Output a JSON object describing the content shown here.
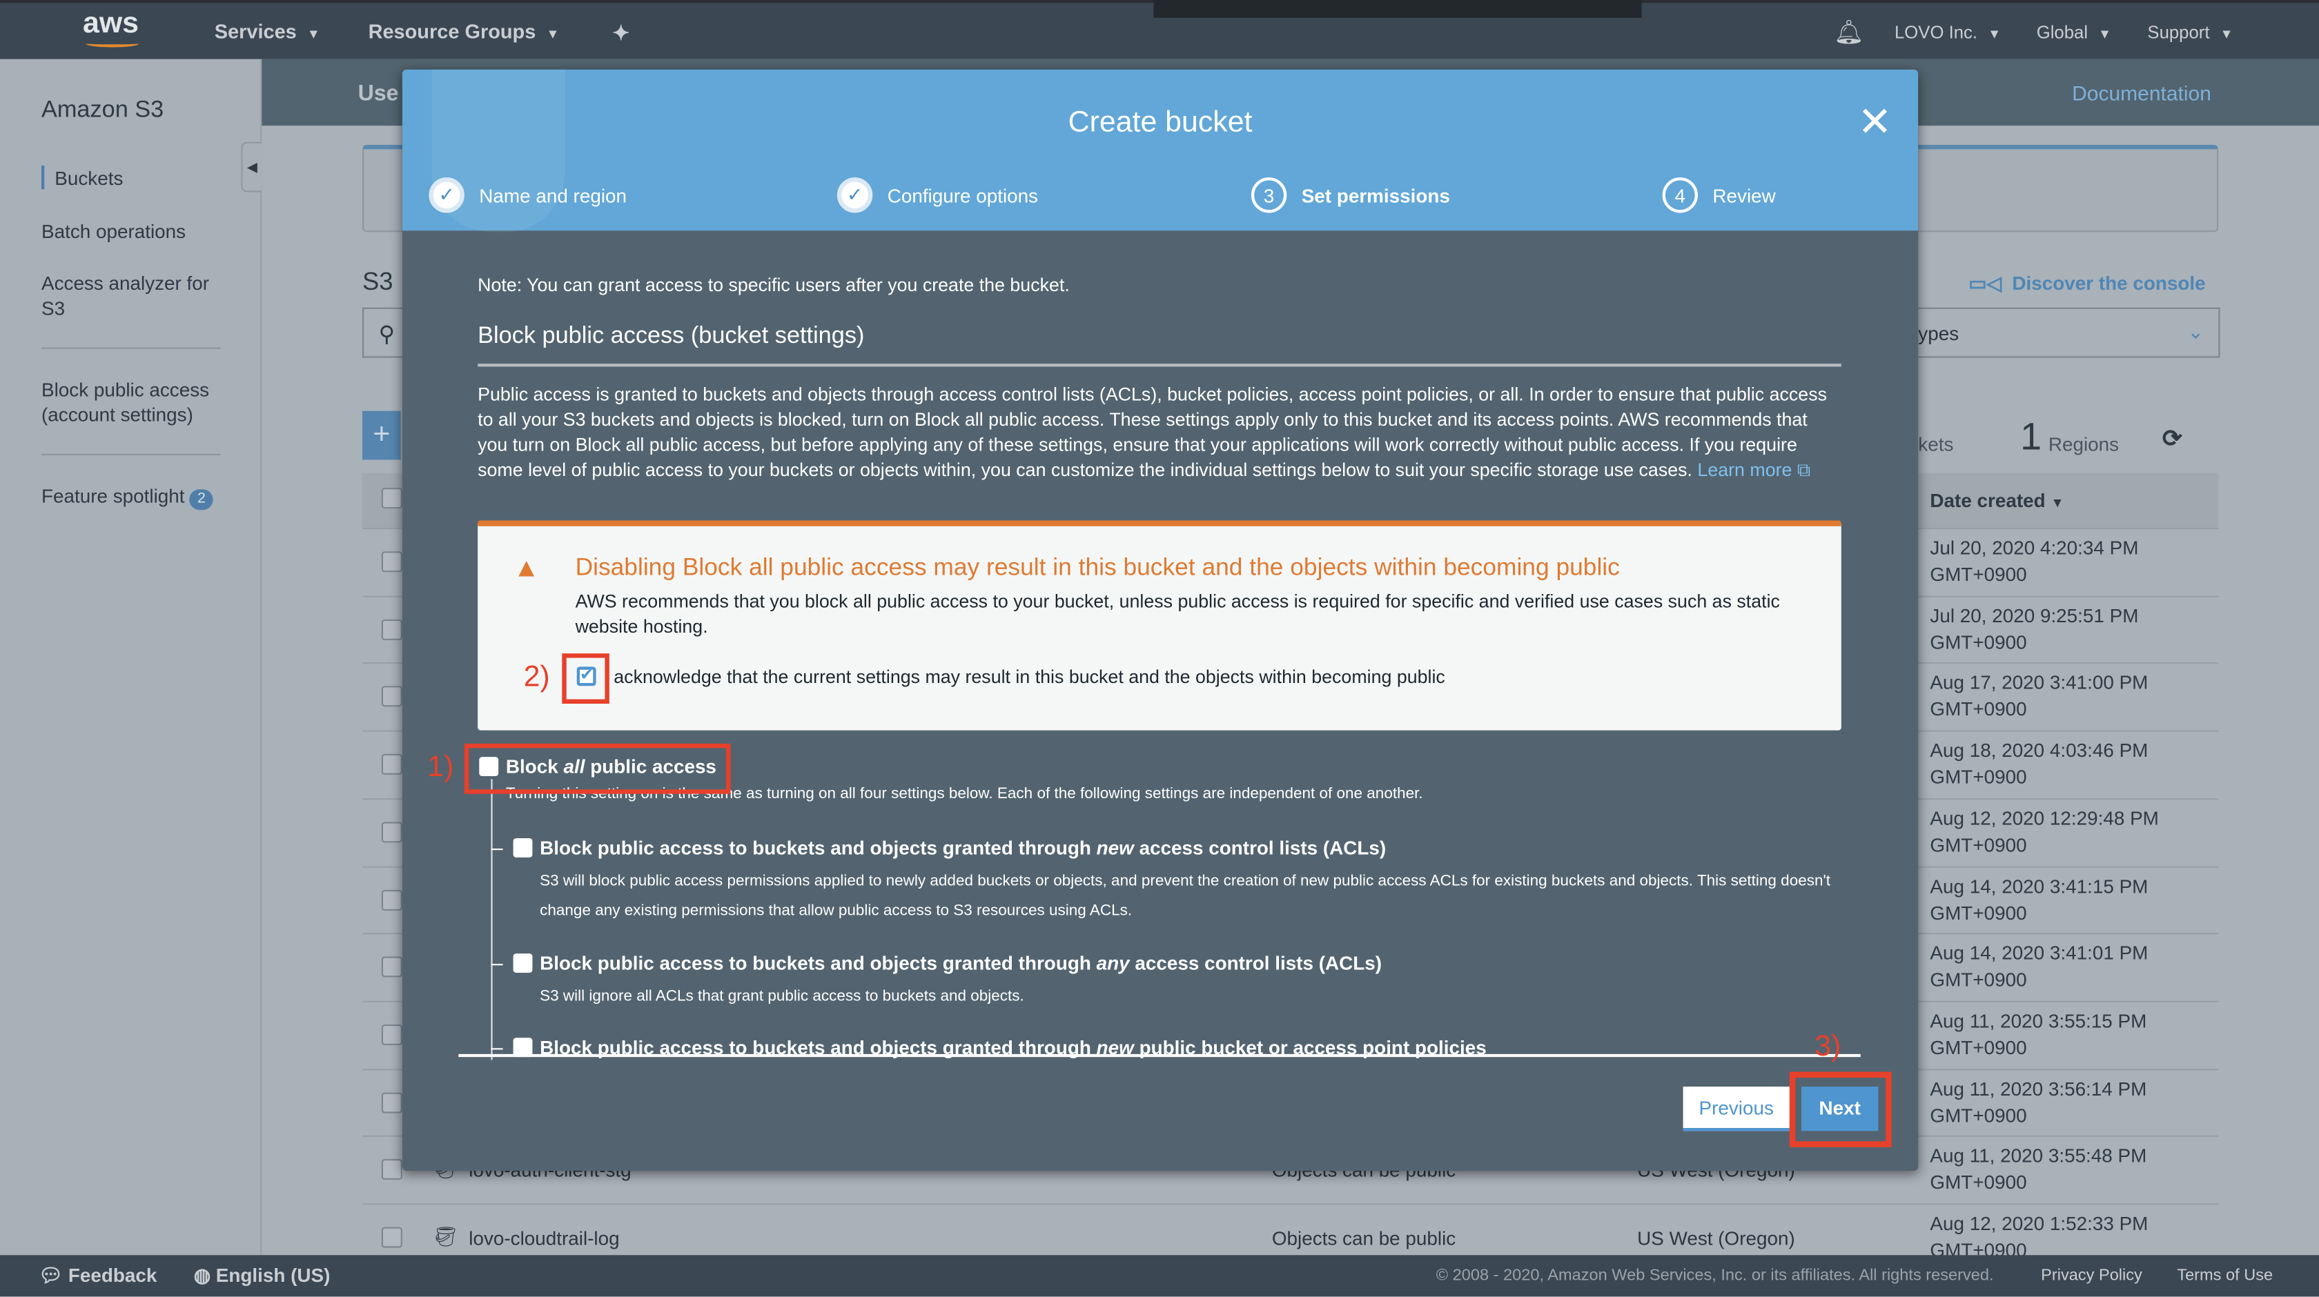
{
  "topnav": {
    "logo": "aws",
    "services": "Services",
    "resource_groups": "Resource Groups",
    "account": "LOVO Inc.",
    "region": "Global",
    "support": "Support"
  },
  "sidebar": {
    "title": "Amazon S3",
    "items": [
      {
        "label": "Buckets"
      },
      {
        "label": "Batch operations"
      },
      {
        "label": "Access analyzer for S3"
      },
      {
        "label": "Block public access (account settings)"
      },
      {
        "label": "Feature spotlight",
        "badge": "2"
      }
    ]
  },
  "main": {
    "header_partial": "Use",
    "documentation": "Documentation",
    "section_partial": "S3",
    "discover": "Discover the console",
    "filter_partial": "ypes",
    "buckets_partial": "kets",
    "regions_count": "1",
    "regions_label": "Regions",
    "date_header": "Date created",
    "rows": [
      {
        "date": "Jul 20, 2020 4:20:34 PM",
        "tz": "GMT+0900"
      },
      {
        "date": "Jul 20, 2020 9:25:51 PM",
        "tz": "GMT+0900"
      },
      {
        "date": "Aug 17, 2020 3:41:00 PM",
        "tz": "GMT+0900"
      },
      {
        "date": "Aug 18, 2020 4:03:46 PM",
        "tz": "GMT+0900"
      },
      {
        "date": "Aug 12, 2020 12:29:48 PM",
        "tz": "GMT+0900"
      },
      {
        "date": "Aug 14, 2020 3:41:15 PM",
        "tz": "GMT+0900"
      },
      {
        "date": "Aug 14, 2020 3:41:01 PM",
        "tz": "GMT+0900"
      },
      {
        "date": "Aug 11, 2020 3:55:15 PM",
        "tz": "GMT+0900"
      },
      {
        "date": "Aug 11, 2020 3:56:14 PM",
        "tz": "GMT+0900"
      },
      {
        "name": "lovo-auth-client-stg",
        "access": "Objects can be public",
        "region": "US West (Oregon)",
        "date": "Aug 11, 2020 3:55:48 PM",
        "tz": "GMT+0900"
      },
      {
        "name": "lovo-cloudtrail-log",
        "access": "Objects can be public",
        "region": "US West (Oregon)",
        "date": "Aug 12, 2020 1:52:33 PM",
        "tz": "GMT+0900"
      }
    ]
  },
  "modal": {
    "title": "Create bucket",
    "steps": [
      {
        "num": "1",
        "label": "Name and region",
        "state": "done"
      },
      {
        "num": "2",
        "label": "Configure options",
        "state": "done"
      },
      {
        "num": "3",
        "label": "Set permissions",
        "state": "current"
      },
      {
        "num": "4",
        "label": "Review",
        "state": "pending"
      }
    ],
    "note": "Note: You can grant access to specific users after you create the bucket.",
    "section_title": "Block public access (bucket settings)",
    "description": "Public access is granted to buckets and objects through access control lists (ACLs), bucket policies, access point policies, or all. In order to ensure that public access to all your S3 buckets and objects is blocked, turn on Block all public access. These settings apply only to this bucket and its access points. AWS recommends that you turn on Block all public access, but before applying any of these settings, ensure that your applications will work correctly without public access. If you require some level of public access to your buckets or objects within, you can customize the individual settings below to suit your specific storage use cases.",
    "learn_more": "Learn more",
    "warning": {
      "title": "Disabling Block all public access may result in this bucket and the objects within becoming public",
      "body": "AWS recommends that you block all public access to your bucket, unless public access is required for specific and verified use cases such as static website hosting.",
      "acknowledge": "acknowledge that the current settings may result in this bucket and the objects within becoming public",
      "acknowledged": true
    },
    "block_all": {
      "label_pre": "Block ",
      "label_em": "all",
      "label_post": " public access",
      "checked": false,
      "desc": "Turning this setting on is the same as turning on all four settings below. Each of the following settings are independent of one another."
    },
    "options": [
      {
        "pre": "Block public access to buckets and objects granted through ",
        "em": "new",
        "post": " access control lists (ACLs)",
        "desc": "S3 will block public access permissions applied to newly added buckets or objects, and prevent the creation of new public access ACLs for existing buckets and objects. This setting doesn't change any existing permissions that allow public access to S3 resources using ACLs.",
        "checked": false
      },
      {
        "pre": "Block public access to buckets and objects granted through ",
        "em": "any",
        "post": " access control lists (ACLs)",
        "desc": "S3 will ignore all ACLs that grant public access to buckets and objects.",
        "checked": false
      },
      {
        "pre": "Block public access to buckets and objects granted through ",
        "em": "new",
        "post": " public bucket or access point policies",
        "checked": false
      }
    ],
    "previous": "Previous",
    "next": "Next"
  },
  "annotations": {
    "a1": "1)",
    "a2": "2)",
    "a3": "3)",
    "color": "#e8402a"
  },
  "footer": {
    "feedback": "Feedback",
    "language": "English (US)",
    "copyright": "© 2008 - 2020, Amazon Web Services, Inc. or its affiliates. All rights reserved.",
    "privacy": "Privacy Policy",
    "terms": "Terms of Use"
  },
  "colors": {
    "modal_header": "#62a7d8",
    "modal_body": "#536470",
    "warning": "#e07a31",
    "primary": "#4f95d0",
    "nav": "#3b4753"
  }
}
